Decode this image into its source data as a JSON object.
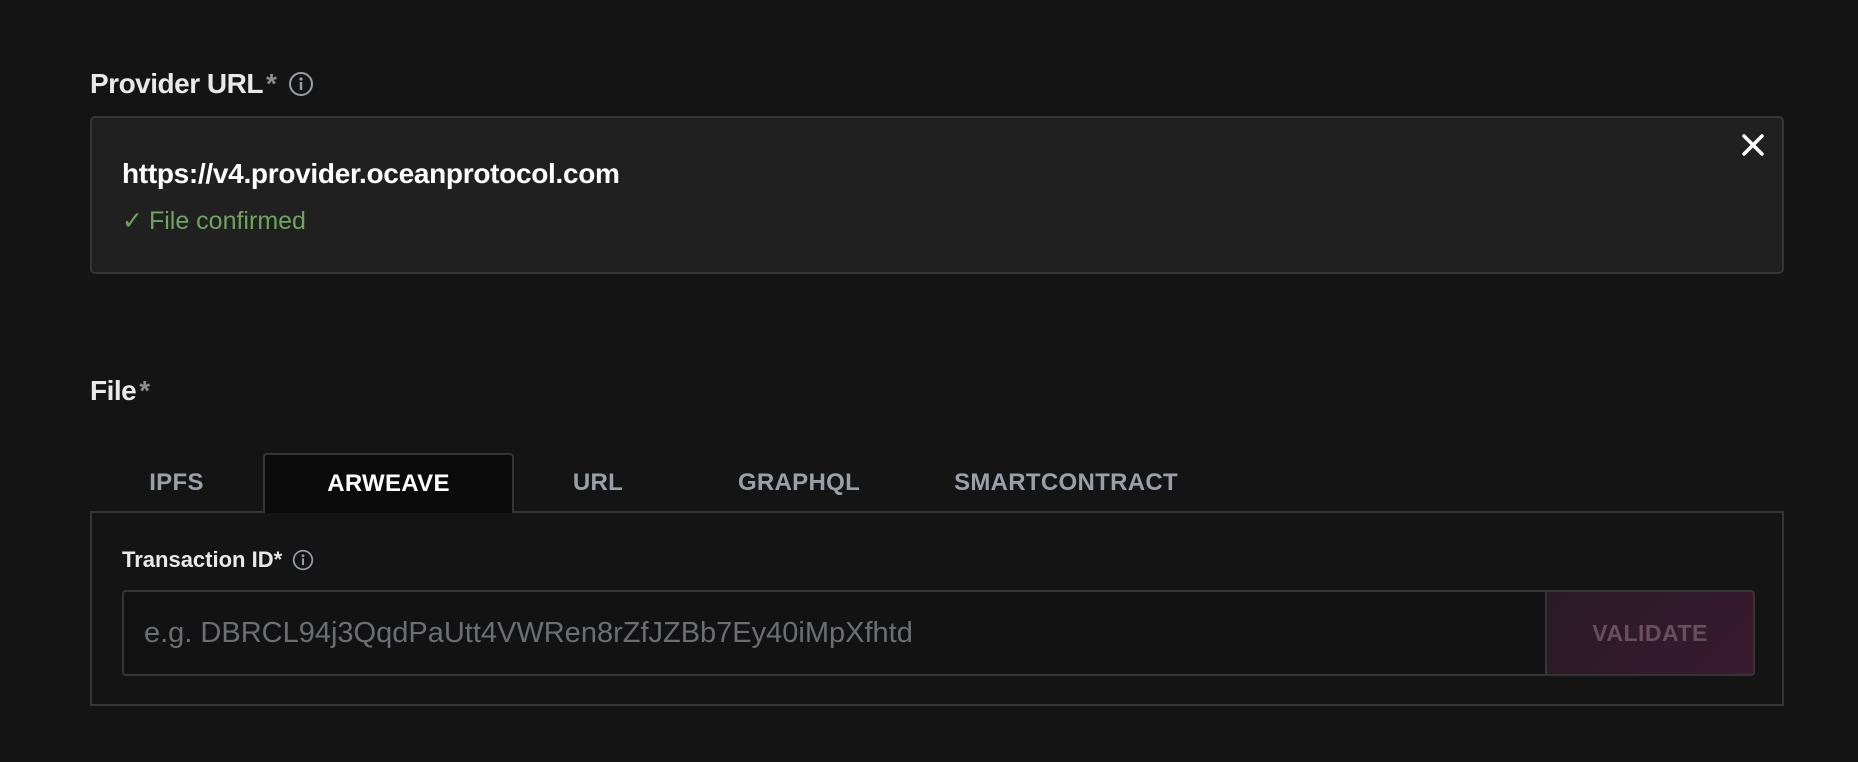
{
  "provider": {
    "label": "Provider URL",
    "required_mark": "*",
    "info_icon": "info-circle-icon",
    "url": "https://v4.provider.oceanprotocol.com",
    "status_check": "✓",
    "status_text": "File confirmed",
    "status_color": "#6ea55c",
    "close_icon": "close-icon"
  },
  "file": {
    "label": "File",
    "required_mark": "*",
    "tabs": [
      {
        "label": "IPFS",
        "active": false
      },
      {
        "label": "ARWEAVE",
        "active": true
      },
      {
        "label": "URL",
        "active": false
      },
      {
        "label": "GRAPHQL",
        "active": false
      },
      {
        "label": "SMARTCONTRACT",
        "active": false
      }
    ],
    "transaction": {
      "label": "Transaction ID*",
      "info_icon": "info-circle-icon",
      "placeholder": "e.g. DBRCL94j3QqdPaUtt4VWRen8rZfJZBb7Ey40iMpXfhtd",
      "value": "",
      "validate_label": "VALIDATE",
      "validate_disabled": true
    }
  },
  "colors": {
    "background": "#141414",
    "panel": "#202020",
    "border": "#343536",
    "success": "#6ea55c",
    "accent_disabled": "#3a1a2e"
  }
}
